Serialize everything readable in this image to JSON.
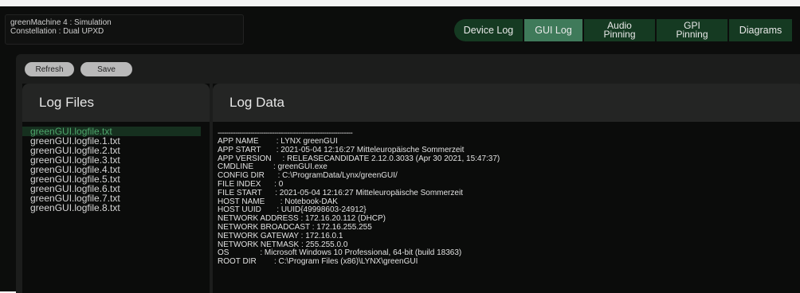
{
  "device": {
    "line1": "greenMachine 4 : Simulation",
    "line2": "Constellation : Dual UPXD"
  },
  "tabs": [
    {
      "label": "Device Log",
      "active": false
    },
    {
      "label": "GUI Log",
      "active": true
    },
    {
      "label": "Audio\nPinning",
      "active": false
    },
    {
      "label": "GPI\nPinning",
      "active": false
    },
    {
      "label": "Diagrams",
      "active": false
    }
  ],
  "toolbar": {
    "refresh_label": "Refresh",
    "save_label": "Save"
  },
  "log_files": {
    "title": "Log Files",
    "items": [
      "greenGUI.logfile.txt",
      "greenGUI.logfile.1.txt",
      "greenGUI.logfile.2.txt",
      "greenGUI.logfile.3.txt",
      "greenGUI.logfile.4.txt",
      "greenGUI.logfile.5.txt",
      "greenGUI.logfile.6.txt",
      "greenGUI.logfile.7.txt",
      "greenGUI.logfile.8.txt"
    ],
    "selected_index": 0
  },
  "log_data": {
    "title": "Log Data",
    "separator": "--------------------------------------------------------------",
    "entries": [
      {
        "key": "APP NAME        ",
        "value": ": LYNX greenGUI"
      },
      {
        "key": "APP START       ",
        "value": ": 2021-05-04 12:16:27 Mitteleuropäische Sommerzeit"
      },
      {
        "key": "APP VERSION     ",
        "value": ": RELEASECANDIDATE 2.12.0.3033 (Apr 30 2021, 15:47:37)"
      },
      {
        "key": "CMDLINE         ",
        "value": ": greenGUI.exe"
      },
      {
        "key": "CONFIG DIR      ",
        "value": ": C:\\ProgramData/Lynx/greenGUI/"
      },
      {
        "key": "FILE INDEX      ",
        "value": ": 0"
      },
      {
        "key": "FILE START      ",
        "value": ": 2021-05-04 12:16:27 Mitteleuropäische Sommerzeit"
      },
      {
        "key": "HOST NAME       ",
        "value": ": Notebook-DAK"
      },
      {
        "key": "HOST UUID       ",
        "value": ": UUID{49998603-24912}"
      },
      {
        "key": "NETWORK ADDRESS ",
        "value": ": 172.16.20.112 (DHCP)"
      },
      {
        "key": "NETWORK BROADCAST ",
        "value": ": 172.16.255.255"
      },
      {
        "key": "NETWORK GATEWAY ",
        "value": ": 172.16.0.1"
      },
      {
        "key": "NETWORK NETMASK ",
        "value": ": 255.255.0.0"
      },
      {
        "key": "OS              ",
        "value": ": Microsoft Windows 10 Professional, 64-bit (build 18363)"
      },
      {
        "key": "ROOT DIR        ",
        "value": ": C:\\Program Files (x86)\\LYNX\\greenGUI"
      }
    ]
  },
  "colors": {
    "accent_green": "#4ea56b",
    "tab_bg": "#153a22",
    "tab_active_bg": "#3f7a5a",
    "panel_bg": "#0b0c0b"
  }
}
